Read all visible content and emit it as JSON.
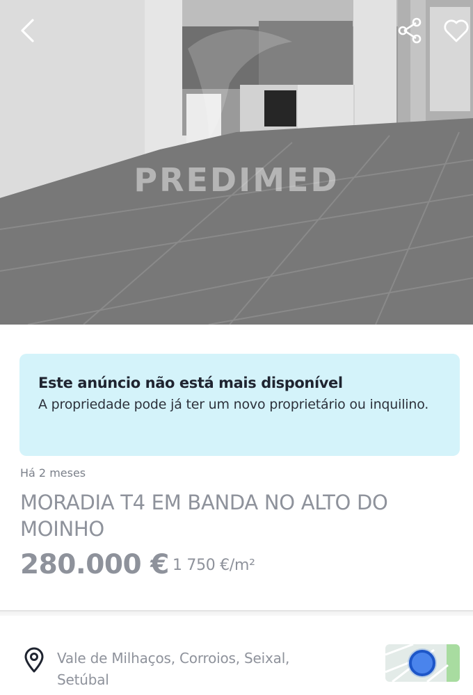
{
  "hero": {
    "watermark": "PREDIMED"
  },
  "header": {
    "back_icon": "chevron-left-icon",
    "share_icon": "share-icon",
    "favorite_icon": "heart-outline-icon"
  },
  "notice": {
    "title": "Este anúncio não está mais disponível",
    "text": "A propriedade pode já ter um novo proprietário ou inquilino.",
    "background": "#d4f3fa"
  },
  "listing": {
    "time_ago": "Há 2 meses",
    "title": "MORADIA T4 EM BANDA NO ALTO DO MOINHO",
    "price": "280.000 €",
    "price_per_m2": "1 750 €/m²"
  },
  "location": {
    "pin_icon": "location-pin-icon",
    "address": "Vale de Milhaços, Corroios, Seixal, Setúbal"
  }
}
